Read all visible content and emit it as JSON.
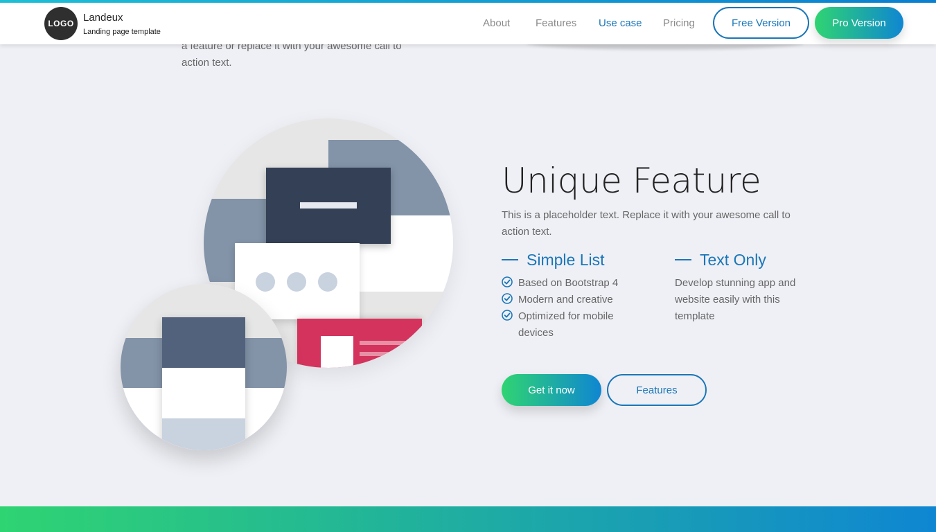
{
  "header": {
    "logo_text": "LOGO",
    "brand_title": "Landeux",
    "brand_subtitle": "Landing page template",
    "nav": [
      {
        "label": "About",
        "active": false
      },
      {
        "label": "Features",
        "active": false
      },
      {
        "label": "Use case",
        "active": true
      },
      {
        "label": "Pricing",
        "active": false
      }
    ],
    "free_button": "Free Version",
    "pro_button": "Pro Version"
  },
  "previous_section": {
    "text": "a feature or replace it with your awesome call to action text."
  },
  "feature": {
    "title": "Unique Feature",
    "description": "This is a placeholder text. Replace it with your awesome call to action text.",
    "col1": {
      "title": "Simple List",
      "items": [
        "Based on Bootstrap 4",
        "Modern and creative",
        "Optimized for mobile devices"
      ]
    },
    "col2": {
      "title": "Text Only",
      "text": "Develop stunning app and website easily with this template"
    },
    "primary_button": "Get it now",
    "secondary_button": "Features"
  },
  "colors": {
    "accent": "#1a76b8",
    "gradient_start": "#2fd472",
    "gradient_end": "#0f86d2",
    "background": "#eff0f5",
    "slate": "#344055",
    "crimson": "#d3335c"
  },
  "icons": {
    "check": "check-circle-icon"
  }
}
